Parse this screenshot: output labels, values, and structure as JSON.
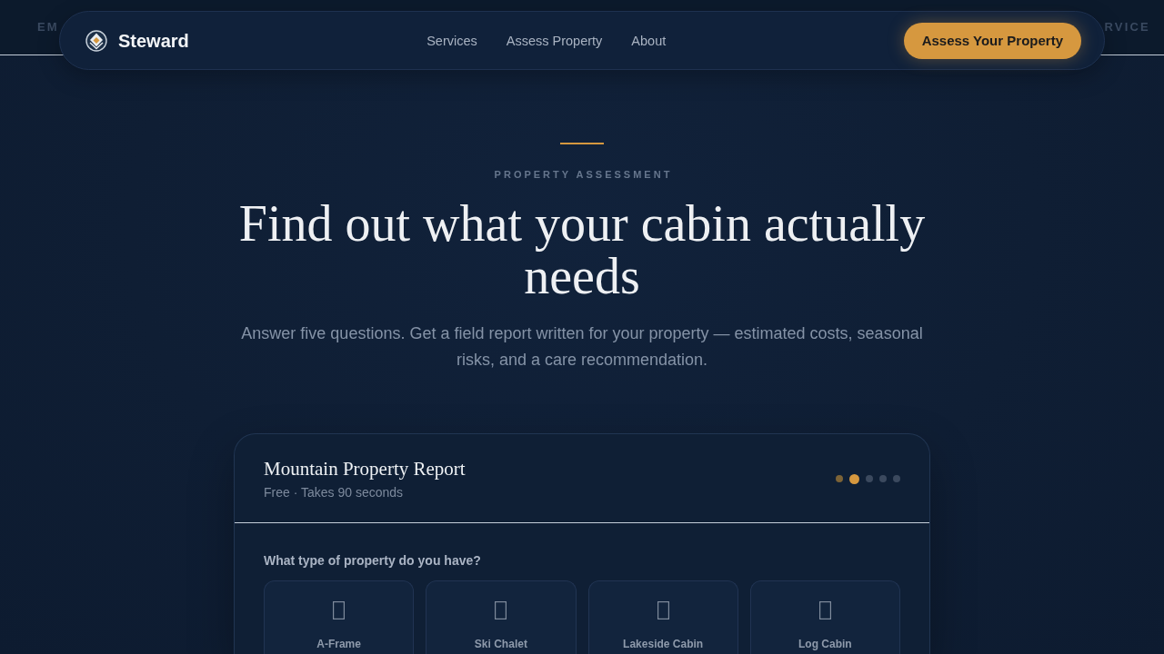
{
  "background_bar": {
    "left_text": "EM",
    "right_text": "RVICE"
  },
  "nav": {
    "brand": "Steward",
    "links": [
      {
        "label": "Services"
      },
      {
        "label": "Assess Property"
      },
      {
        "label": "About"
      }
    ],
    "cta": "Assess Your Property"
  },
  "hero": {
    "eyebrow": "PROPERTY ASSESSMENT",
    "title": "Find out what your cabin actually needs",
    "subtitle": "Answer five questions. Get a field report written for your property — estimated costs, seasonal risks, and a care recommendation."
  },
  "assessment": {
    "title": "Mountain Property Report",
    "subtitle": "Free · Takes 90 seconds",
    "steps": [
      {
        "done": true,
        "selected": false
      },
      {
        "done": false,
        "selected": true
      },
      {
        "done": false,
        "selected": false
      },
      {
        "done": false,
        "selected": false
      },
      {
        "done": false,
        "selected": false
      }
    ],
    "question": "What type of property do you have?",
    "options": [
      {
        "label": "A-Frame",
        "selected": false
      },
      {
        "label": "Ski Chalet",
        "selected": false
      },
      {
        "label": "Lakeside Cabin",
        "selected": false
      },
      {
        "label": "Log Cabin",
        "selected": false
      }
    ]
  }
}
